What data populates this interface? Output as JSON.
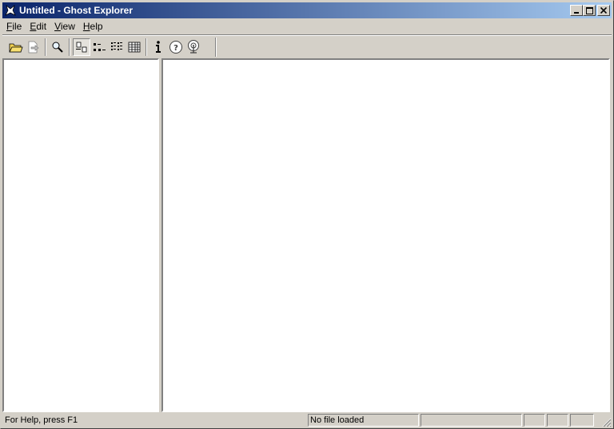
{
  "window": {
    "title": "Untitled - Ghost Explorer"
  },
  "menu": [
    {
      "label": "File",
      "accel": "F",
      "rest": "ile"
    },
    {
      "label": "Edit",
      "accel": "E",
      "rest": "dit"
    },
    {
      "label": "View",
      "accel": "V",
      "rest": "iew"
    },
    {
      "label": "Help",
      "accel": "H",
      "rest": "elp"
    }
  ],
  "toolbar": {
    "buttons": [
      "open-folder-icon",
      "export-icon",
      "search-icon",
      "large-icons-view-icon",
      "small-icons-view-icon",
      "list-view-icon",
      "details-view-icon",
      "info-icon",
      "help-icon",
      "broadcast-icon"
    ],
    "pressed": "large-icons-view-icon"
  },
  "status": {
    "help_text": "For Help, press F1",
    "file_state": "No file loaded"
  },
  "colors": {
    "title_start": "#0a246a",
    "title_end": "#a6caf0",
    "face": "#d4d0c8"
  }
}
